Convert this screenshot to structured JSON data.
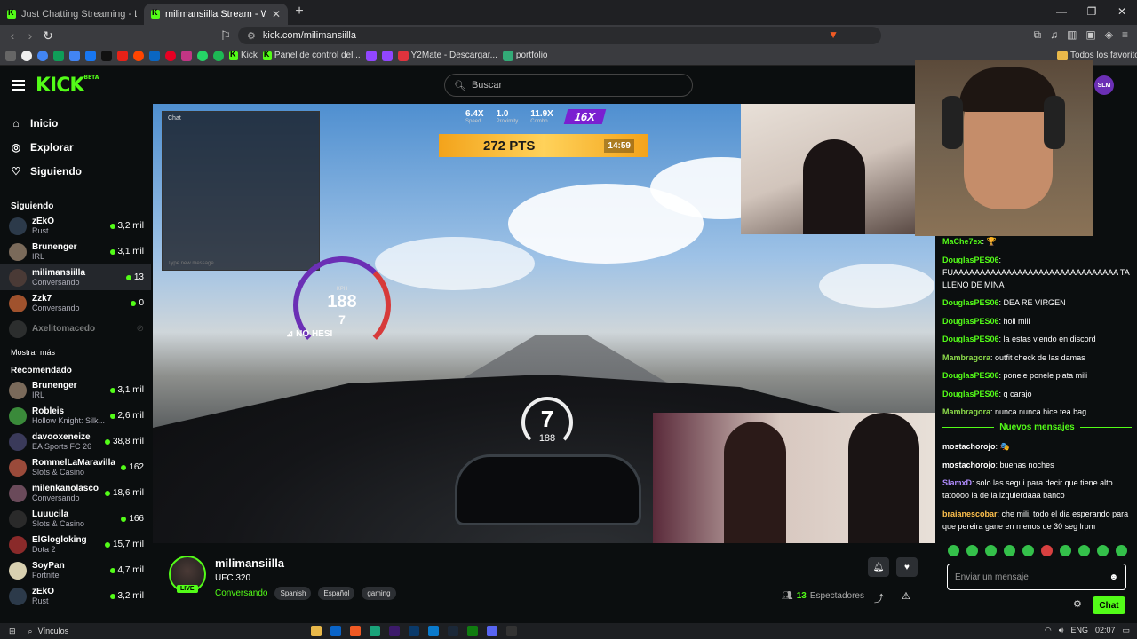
{
  "browser": {
    "tabs": [
      {
        "label": "Just Chatting Streaming - Live Stream",
        "active": false
      },
      {
        "label": "milimansiilla Stream - Watch Live",
        "active": true
      }
    ],
    "url": "kick.com/milimansiilla",
    "bookmarks": [
      "Kick",
      "Panel de control del...",
      "Y2Mate - Descargar...",
      "portfolio",
      "Todos los favoritos"
    ]
  },
  "header": {
    "logo": "KICK",
    "beta": "BETA",
    "search_placeholder": "Buscar",
    "user_avatar": "SLM"
  },
  "nav": [
    {
      "label": "Inicio",
      "icon": "home-icon"
    },
    {
      "label": "Explorar",
      "icon": "compass-icon"
    },
    {
      "label": "Siguiendo",
      "icon": "heart-icon"
    }
  ],
  "following": {
    "title": "Siguiendo",
    "channels": [
      {
        "name": "zEkO",
        "category": "Rust",
        "viewers": "3,2 mil",
        "color": "#2c3a4a"
      },
      {
        "name": "Brunenger",
        "category": "IRL",
        "viewers": "3,1 mil",
        "color": "#7a6a5a"
      },
      {
        "name": "milimansiilla",
        "category": "Conversando",
        "viewers": "13",
        "color": "#4a3a36"
      },
      {
        "name": "Zzk7",
        "category": "Conversando",
        "viewers": "0",
        "color": "#a0522d"
      },
      {
        "name": "Axelitomacedo",
        "category": "",
        "viewers": "",
        "color": "#555555"
      }
    ],
    "show_more": "Mostrar más"
  },
  "recommended": {
    "title": "Recomendado",
    "channels": [
      {
        "name": "Brunenger",
        "category": "IRL",
        "viewers": "3,1 mil",
        "color": "#7a6a5a"
      },
      {
        "name": "Robleis",
        "category": "Hollow Knight: Silk...",
        "viewers": "2,6 mil",
        "color": "#3a8a3a"
      },
      {
        "name": "davooxeneize",
        "category": "EA Sports FC 26",
        "viewers": "38,8 mil",
        "color": "#3a3a5a"
      },
      {
        "name": "RommelLaMaravilla",
        "category": "Slots & Casino",
        "viewers": "162",
        "color": "#9a4a3a"
      },
      {
        "name": "milenkanolasco",
        "category": "Conversando",
        "viewers": "18,6 mil",
        "color": "#6a4a5a"
      },
      {
        "name": "Luuucila",
        "category": "Slots & Casino",
        "viewers": "166",
        "color": "#2a2a2a"
      },
      {
        "name": "ElGlogloking",
        "category": "Dota 2",
        "viewers": "15,7 mil",
        "color": "#8a2a2a"
      },
      {
        "name": "SoyPan",
        "category": "Fortnite",
        "viewers": "4,7 mil",
        "color": "#d8d0b0"
      },
      {
        "name": "zEkO",
        "category": "Rust",
        "viewers": "3,2 mil",
        "color": "#2c3a4a"
      }
    ]
  },
  "video_hud": {
    "stats": [
      {
        "value": "6.4X",
        "label": "Speed"
      },
      {
        "value": "1.0",
        "label": "Proximity"
      },
      {
        "value": "11.9X",
        "label": "Combo"
      }
    ],
    "multiplier": "16X",
    "points": "272 PTS",
    "timer": "14:59",
    "speed_unit": "KPH",
    "speed": "188",
    "gear": "7",
    "mode": "NO HESI",
    "overlay_chat_title": "Chat",
    "overlay_chat_placeholder": "Type new message..."
  },
  "stream": {
    "name": "milimansiilla",
    "title": "UFC 320",
    "category": "Conversando",
    "tags": [
      "Spanish",
      "Español",
      "gaming"
    ],
    "viewers": "13",
    "viewers_label": "Espectadores",
    "live": "LIVE"
  },
  "chat": {
    "messages": [
      {
        "user": "MaChe7ex",
        "text": "🏆",
        "color": "#53fc18"
      },
      {
        "user": "DouglasPES06",
        "text": "FUAAAAAAAAAAAAAAAAAAAAAAAAAAAAAAA TA LLENO DE MINA",
        "color": "#53fc18"
      },
      {
        "user": "DouglasPES06",
        "text": "DEA RE VIRGEN",
        "color": "#53fc18"
      },
      {
        "user": "DouglasPES06",
        "text": "holi mili",
        "color": "#53fc18"
      },
      {
        "user": "DouglasPES06",
        "text": "la estas viendo en discord",
        "color": "#53fc18"
      },
      {
        "user": "Mambragora",
        "text": "outfit check de las damas",
        "color": "#8bd94a"
      },
      {
        "user": "DouglasPES06",
        "text": "ponele ponele plata mili",
        "color": "#53fc18"
      },
      {
        "user": "DouglasPES06",
        "text": "q carajo",
        "color": "#53fc18"
      },
      {
        "user": "Mambragora",
        "text": "nunca nunca hice tea bag",
        "color": "#8bd94a"
      }
    ],
    "new_messages": "Nuevos mensajes",
    "new": [
      {
        "user": "mostachorojo",
        "text": "🎭",
        "color": "#ffffff"
      },
      {
        "user": "mostachorojo",
        "text": "buenas noches",
        "color": "#ffffff"
      },
      {
        "user": "SlamxD",
        "text": "solo las segui para decir que tiene alto tatoooo la de la izquierdaaa banco",
        "color": "#b18cff"
      },
      {
        "user": "braianescobar",
        "text": "che mili, todo el dia esperando para que pereira gane en menos de 30 seg lrpm",
        "color": "#ffc14d"
      }
    ],
    "input_placeholder": "Enviar un mensaje",
    "send_label": "Chat"
  },
  "taskbar": {
    "search": "Vínculos",
    "lang": "ENG",
    "time": "02:07"
  }
}
